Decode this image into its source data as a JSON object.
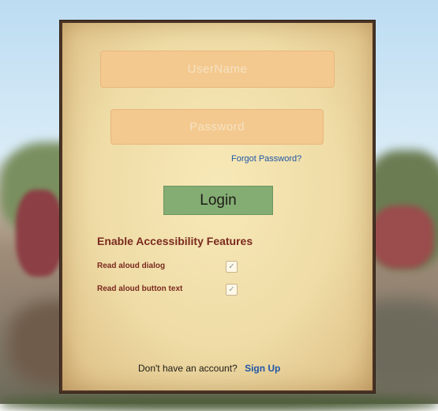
{
  "login_form": {
    "username_placeholder": "UserName",
    "password_placeholder": "Password",
    "forgot_password": "Forgot Password?",
    "login_button": "Login"
  },
  "accessibility": {
    "title": "Enable Accessibility Features",
    "options": [
      {
        "label": "Read aloud dialog",
        "checked": true
      },
      {
        "label": "Read aloud button text",
        "checked": true
      }
    ]
  },
  "signup": {
    "prompt": "Don't have an account?",
    "link": "Sign Up"
  },
  "icons": {
    "checkbox_mark": "checkmark-icon"
  }
}
